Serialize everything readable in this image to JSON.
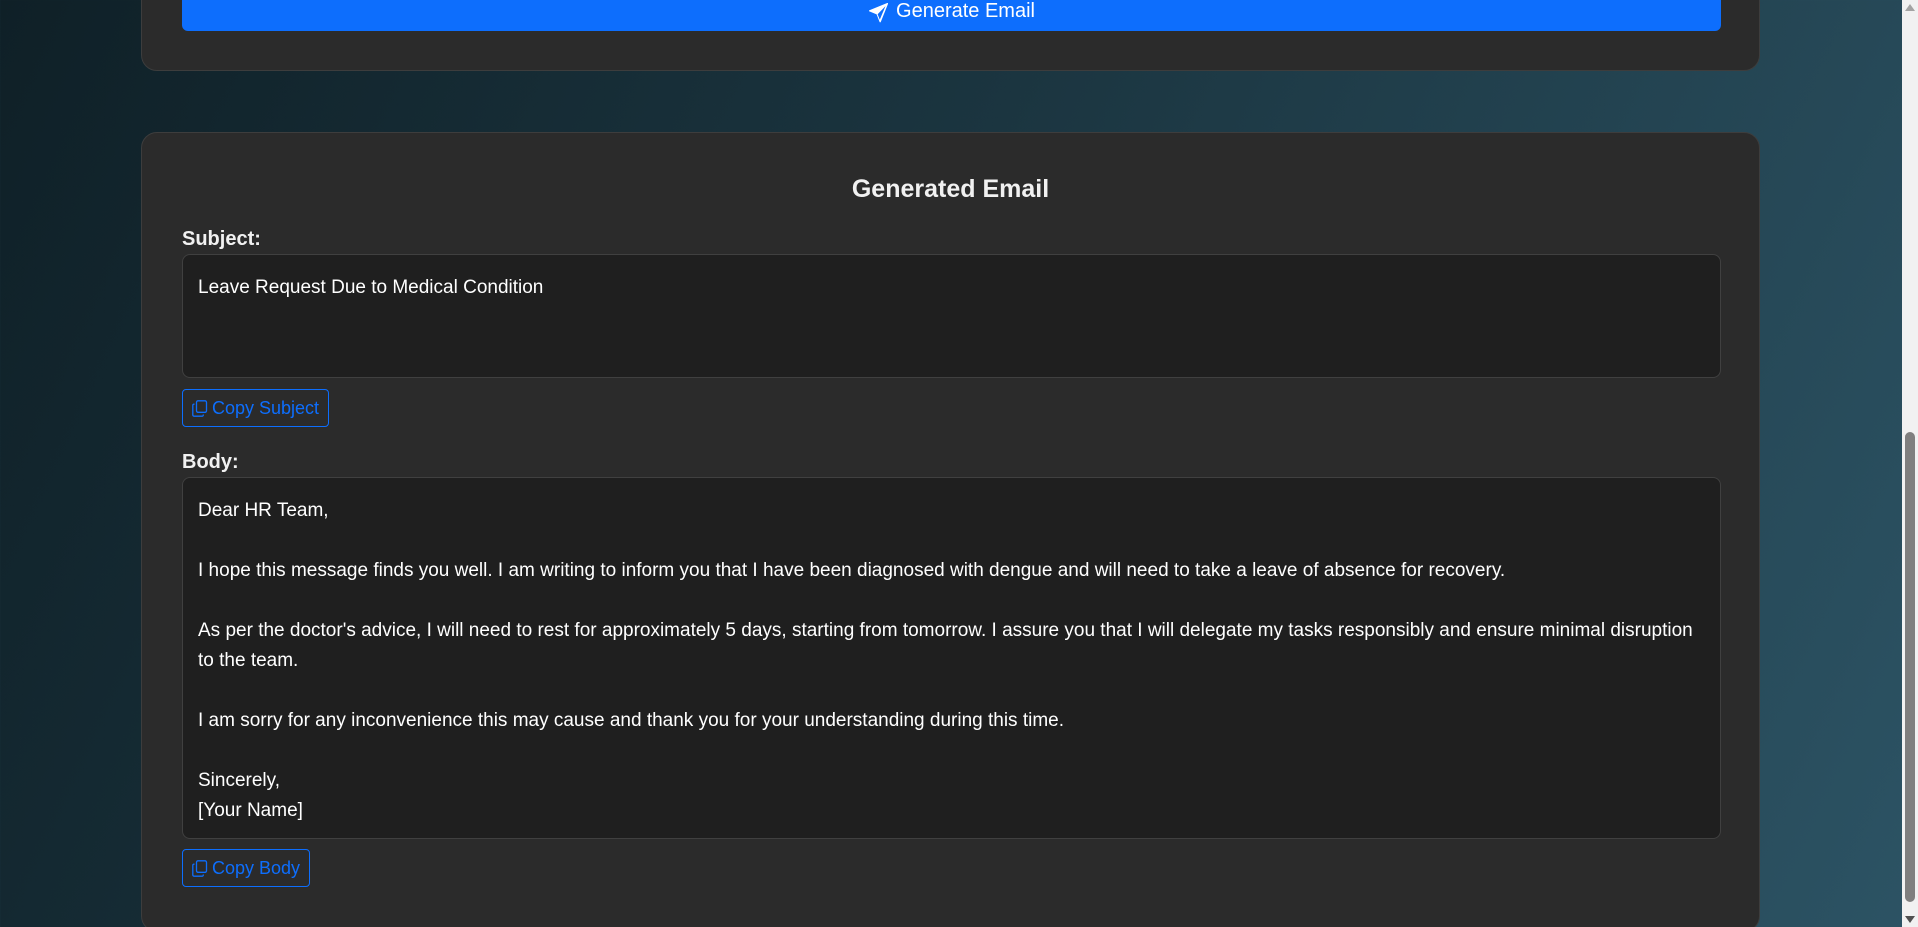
{
  "generate": {
    "label": "Generate Email",
    "icon": "paper-plane-icon"
  },
  "result": {
    "title": "Generated Email",
    "subject_label": "Subject:",
    "subject_value": "Leave Request Due to Medical Condition",
    "copy_subject_label": "Copy Subject",
    "body_label": "Body:",
    "body_value": "Dear HR Team,\n\nI hope this message finds you well. I am writing to inform you that I have been diagnosed with dengue and will need to take a leave of absence for recovery.\n\nAs per the doctor's advice, I will need to rest for approximately 5 days, starting from tomorrow. I assure you that I will delegate my tasks responsibly and ensure minimal disruption to the team.\n\nI am sorry for any inconvenience this may cause and thank you for your understanding during this time.\n\nSincerely,\n[Your Name]",
    "copy_body_label": "Copy Body",
    "copy_icon": "copy-icon"
  },
  "colors": {
    "accent": "#0d6efd",
    "card_bg": "#2b2b2b",
    "field_bg": "#1f1f1f"
  }
}
